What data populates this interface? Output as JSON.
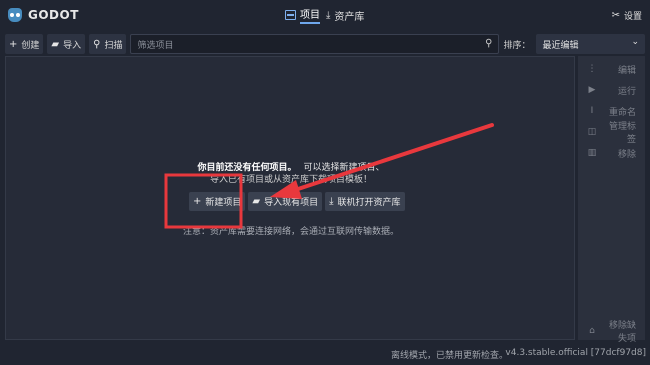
{
  "app": {
    "title": "GODOT"
  },
  "tabs": {
    "projects": "项目",
    "assets": "资产库"
  },
  "settings_label": "设置",
  "toolbar": {
    "create": "创建",
    "import": "导入",
    "scan": "扫描",
    "filter_placeholder": "筛选项目",
    "sort_label": "排序：",
    "sort_value": "最近编辑"
  },
  "side_actions": {
    "edit": "编辑",
    "run": "运行",
    "rename": "重命名",
    "manage_tags": "管理标签",
    "remove": "移除",
    "remove_missing": "移除缺失项"
  },
  "empty_state": {
    "title_bold": "你目前还没有任何项目。",
    "title_rest": "可以选择新建项目、",
    "subtitle": "导入已有项目或从资产库下载项目模板！",
    "new_project": "新建项目",
    "import_existing": "导入现有项目",
    "open_asset_lib": "联机打开资产库",
    "note": "注意：资产库需要连接网络，会通过互联网传输数据。"
  },
  "status": {
    "offline": "离线模式，已禁用更新检查。",
    "version": "v4.3.stable.official [77dcf97d8]"
  },
  "colors": {
    "accent": "#6fa7ec",
    "annotation": "#e8383d"
  }
}
